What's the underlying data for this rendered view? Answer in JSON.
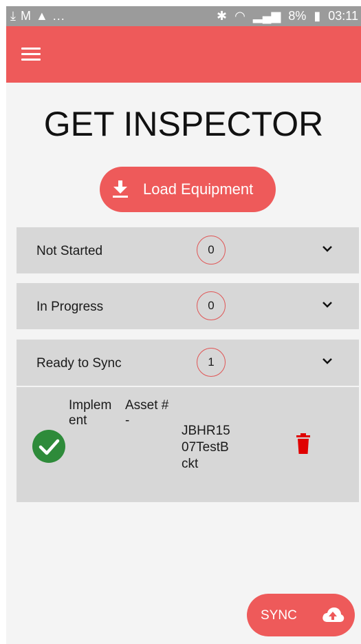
{
  "status_bar": {
    "left_icons": "⤓ M ▲ ...",
    "battery": "8%",
    "time": "03:11"
  },
  "app": {
    "title": "GET INSPECTOR",
    "load_button_label": "Load Equipment"
  },
  "sections": [
    {
      "label": "Not Started",
      "count": "0"
    },
    {
      "label": "In Progress",
      "count": "0"
    },
    {
      "label": "Ready to Sync",
      "count": "1"
    }
  ],
  "ready_item": {
    "type_header_line1": "Implem",
    "type_header_line2": "ent",
    "asset_header": "Asset #",
    "asset_header_dash": "-",
    "asset_line1": "JBHR15",
    "asset_line2": "07TestB",
    "asset_line3": "ckt"
  },
  "sync_button": {
    "label": "SYNC"
  },
  "colors": {
    "accent": "#ee5a5a",
    "panel": "#d7d7d7",
    "check": "#2e8b3a",
    "trash": "#e00000"
  },
  "icons": [
    "menu-icon",
    "download-icon",
    "chevron-down-icon",
    "check-circle-icon",
    "trash-icon",
    "cloud-upload-icon"
  ]
}
